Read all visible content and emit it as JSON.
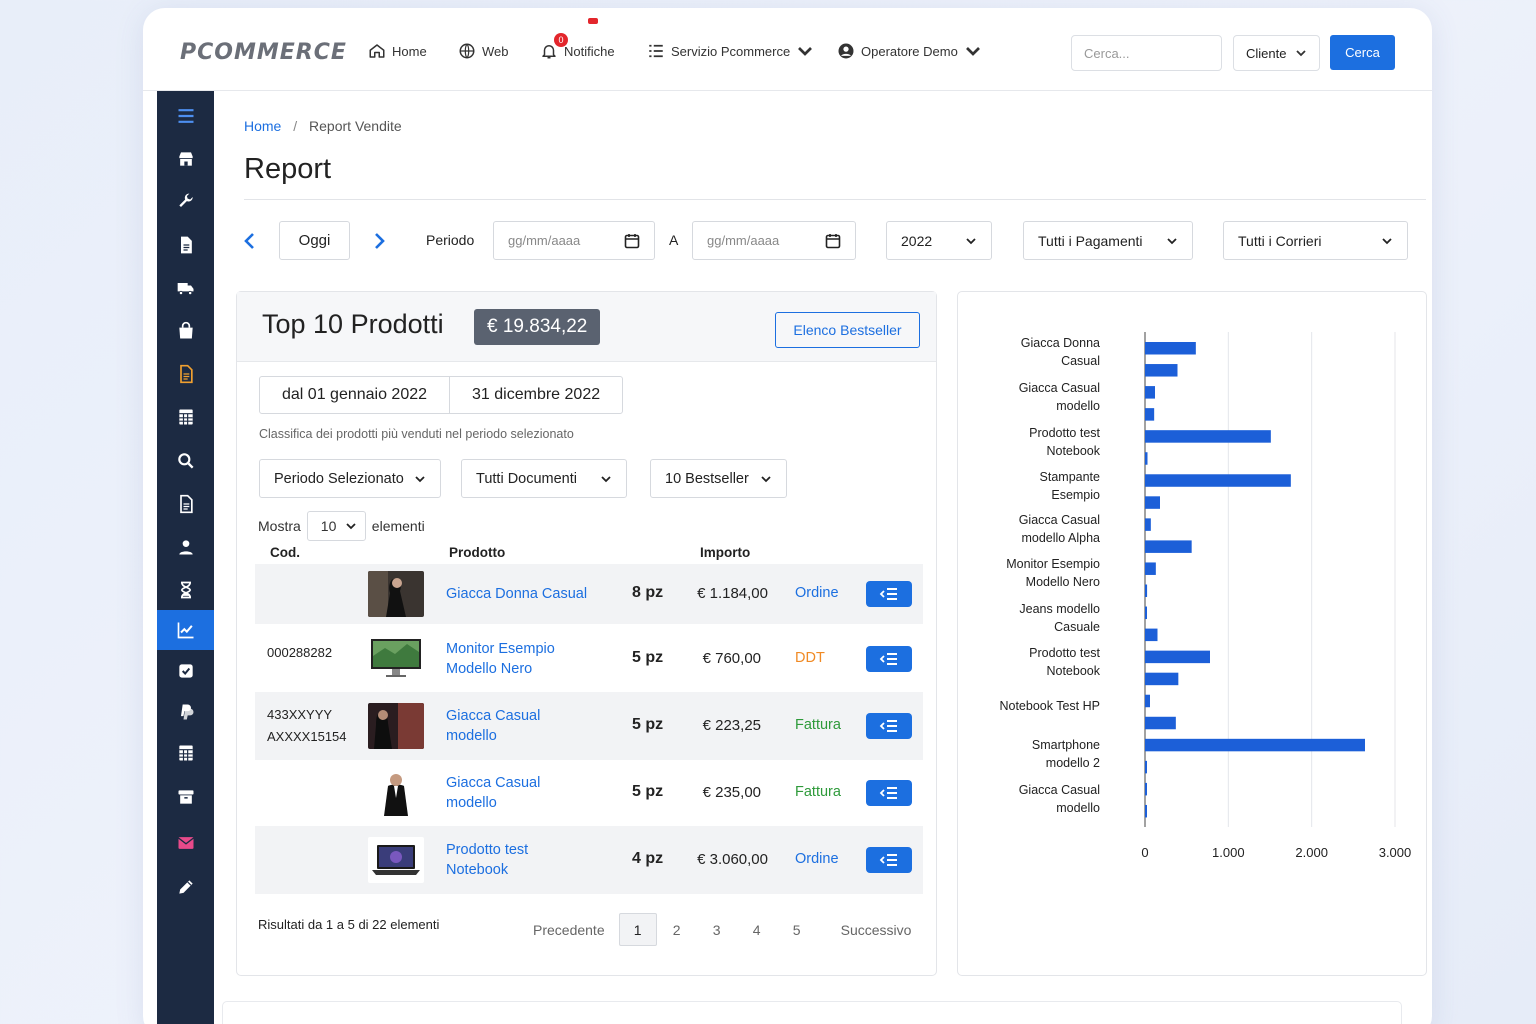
{
  "nav": {
    "brand": "PCOMMERCE",
    "home": "Home",
    "web": "Web",
    "notifications": "Notifiche",
    "notif_count": "0",
    "service": "Servizio Pcommerce",
    "user": "Operatore Demo",
    "search_placeholder": "Cerca...",
    "cliente": "Cliente",
    "cerca": "Cerca"
  },
  "sidebar": {
    "icons": [
      "menu-icon",
      "store-icon",
      "wrench-icon",
      "document-icon",
      "truck-icon",
      "shopping-bag-icon",
      "invoice-icon",
      "calculator-icon",
      "search-icon",
      "file-text-icon",
      "user-icon",
      "hourglass-icon",
      "chart-line-icon",
      "check-square-icon",
      "paypal-icon",
      "calculator-icon",
      "archive-icon",
      "mail-icon",
      "pencil-icon"
    ],
    "active_index": 12,
    "colors": {
      "invoice-icon": "#f0a030",
      "mail-icon": "#e84a8a"
    }
  },
  "breadcrumb": {
    "home": "Home",
    "sep": "/",
    "current": "Report Vendite"
  },
  "page_title": "Report",
  "filters": {
    "today": "Oggi",
    "period_label": "Periodo",
    "date_placeholder": "gg/mm/aaaa",
    "to_label": "A",
    "year": "2022",
    "payments": "Tutti i Pagamenti",
    "couriers": "Tutti i Corrieri"
  },
  "card": {
    "title": "Top 10 Prodotti",
    "total": "€ 19.834,22",
    "bestseller_btn": "Elenco Bestseller",
    "date_from": "dal 01 gennaio 2022",
    "date_to": "31 dicembre 2022",
    "subtitle": "Classifica dei prodotti più venduti nel periodo selezionato",
    "f_period": "Periodo Selezionato",
    "f_docs": "Tutti Documenti",
    "f_best": "10 Bestseller",
    "show_label": "Mostra",
    "show_value": "10",
    "elements_label": "elementi",
    "col_code": "Cod.",
    "col_product": "Prodotto",
    "col_amount": "Importo",
    "rows": [
      {
        "code1": "",
        "code2": "",
        "name1": "Giacca Donna Casual",
        "name2": "",
        "qty": "8 pz",
        "amount": "€ 1.184,00",
        "doc": "Ordine",
        "doc_color": "blue"
      },
      {
        "code1": "000288282",
        "code2": "",
        "name1": "Monitor Esempio",
        "name2": "Modello Nero",
        "qty": "5 pz",
        "amount": "€ 760,00",
        "doc": "DDT",
        "doc_color": "orange"
      },
      {
        "code1": "433XXYYY",
        "code2": "AXXXX15154",
        "name1": "Giacca Casual",
        "name2": "modello",
        "qty": "5 pz",
        "amount": "€ 223,25",
        "doc": "Fattura",
        "doc_color": "green"
      },
      {
        "code1": "",
        "code2": "",
        "name1": "Giacca Casual",
        "name2": "modello",
        "qty": "5 pz",
        "amount": "€ 235,00",
        "doc": "Fattura",
        "doc_color": "green"
      },
      {
        "code1": "",
        "code2": "",
        "name1": "Prodotto test",
        "name2": "Notebook",
        "qty": "4 pz",
        "amount": "€ 3.060,00",
        "doc": "Ordine",
        "doc_color": "blue"
      }
    ],
    "results": "Risultati da 1 a 5 di 22 elementi",
    "prev": "Precedente",
    "pages": [
      "1",
      "2",
      "3",
      "4",
      "5"
    ],
    "current_page": "1",
    "next": "Successivo"
  },
  "chart_data": {
    "type": "bar",
    "orientation": "horizontal",
    "categories": [
      [
        "Giacca Donna",
        "Casual"
      ],
      [
        "Giacca Casual",
        "modello"
      ],
      [
        "Prodotto test",
        "Notebook"
      ],
      [
        "Stampante",
        "Esempio"
      ],
      [
        "Giacca Casual",
        "modello Alpha"
      ],
      [
        "Monitor Esempio",
        "Modello Nero"
      ],
      [
        "Jeans modello",
        "Casuale"
      ],
      [
        "Prodotto test",
        "Notebook"
      ],
      [
        "Notebook Test HP"
      ],
      [
        "Smartphone",
        "modello 2"
      ],
      [
        "Giacca Casual",
        "modello"
      ]
    ],
    "series": [
      {
        "values": [
          610,
          1510,
          30,
          180,
          550,
          25,
          150,
          780,
          60,
          2640,
          15
        ]
      },
      {
        "values": [
          390,
          110,
          0,
          0,
          70,
          130,
          0,
          400,
          370,
          20,
          0
        ]
      },
      {
        "values": [
          0,
          0,
          0,
          0,
          0,
          0,
          0,
          0,
          0,
          0,
          0
        ]
      }
    ],
    "bars_flat": [
      610,
      390,
      120,
      110,
      1510,
      30,
      1750,
      180,
      70,
      560,
      130,
      25,
      20,
      150,
      780,
      400,
      60,
      370,
      2640,
      20,
      15,
      10
    ],
    "xlim": [
      0,
      3000
    ],
    "xticks": [
      "0",
      "1.000",
      "2.000",
      "3.000"
    ],
    "color": "#1c5fd8",
    "grid": true
  }
}
